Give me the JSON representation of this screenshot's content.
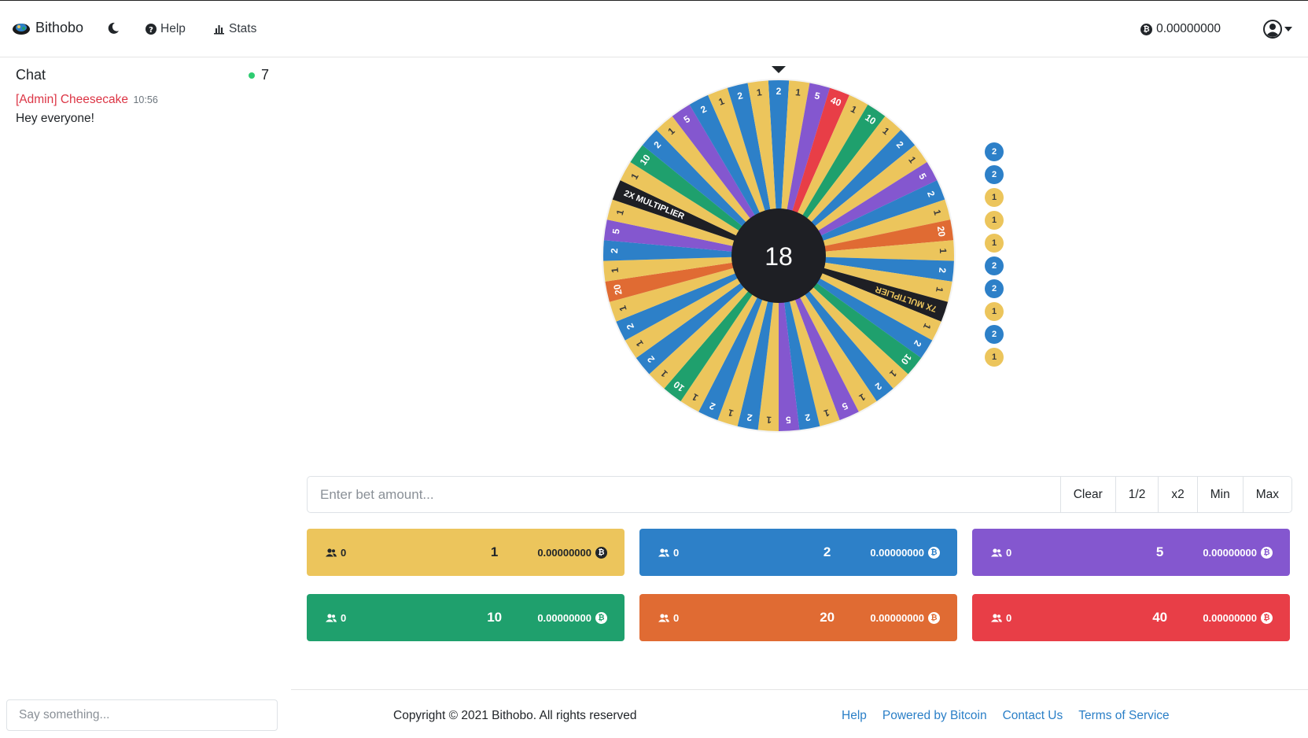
{
  "navbar": {
    "brand": "Bithobo",
    "help": "Help",
    "stats": "Stats",
    "balance": "0.00000000"
  },
  "chat": {
    "title": "Chat",
    "online_count": "7",
    "messages": [
      {
        "author": "[Admin] Cheesecake",
        "time": "10:56",
        "text": "Hey everyone!"
      }
    ],
    "input_placeholder": "Say something..."
  },
  "wheel": {
    "center_value": "18",
    "colors": {
      "1": "#ecc55c",
      "2": "#2d80c8",
      "5": "#8457cf",
      "10": "#1fa06d",
      "20": "#e06b33",
      "40": "#e83e47",
      "2X MULTIPLIER": "#1e1f24",
      "7X MULTIPLIER": "#1e1f24"
    },
    "segments": [
      "2",
      "1",
      "5",
      "40",
      "1",
      "10",
      "1",
      "2",
      "1",
      "5",
      "2",
      "1",
      "20",
      "1",
      "2",
      "1",
      "7X MULTIPLIER",
      "1",
      "2",
      "10",
      "1",
      "2",
      "1",
      "5",
      "1",
      "2",
      "5",
      "1",
      "2",
      "1",
      "2",
      "1",
      "10",
      "1",
      "2",
      "1",
      "2",
      "1",
      "20",
      "1",
      "2",
      "5",
      "1",
      "2X MULTIPLIER",
      "1",
      "10",
      "2",
      "1",
      "5",
      "2",
      "1",
      "2",
      "1"
    ]
  },
  "history": [
    "2",
    "2",
    "1",
    "1",
    "1",
    "2",
    "2",
    "1",
    "2",
    "1"
  ],
  "bet": {
    "placeholder": "Enter bet amount...",
    "buttons": [
      "Clear",
      "1/2",
      "x2",
      "Min",
      "Max"
    ]
  },
  "tiles": [
    {
      "players": "0",
      "multiplier": "1",
      "amount": "0.00000000",
      "color": "#ecc55c"
    },
    {
      "players": "0",
      "multiplier": "2",
      "amount": "0.00000000",
      "color": "#2d80c8"
    },
    {
      "players": "0",
      "multiplier": "5",
      "amount": "0.00000000",
      "color": "#8457cf"
    },
    {
      "players": "0",
      "multiplier": "10",
      "amount": "0.00000000",
      "color": "#1fa06d"
    },
    {
      "players": "0",
      "multiplier": "20",
      "amount": "0.00000000",
      "color": "#e06b33"
    },
    {
      "players": "0",
      "multiplier": "40",
      "amount": "0.00000000",
      "color": "#e83e47"
    }
  ],
  "footer": {
    "copyright": "Copyright © 2021 Bithobo. All rights reserved",
    "links": [
      "Help",
      "Powered by Bitcoin",
      "Contact Us",
      "Terms of Service"
    ]
  }
}
